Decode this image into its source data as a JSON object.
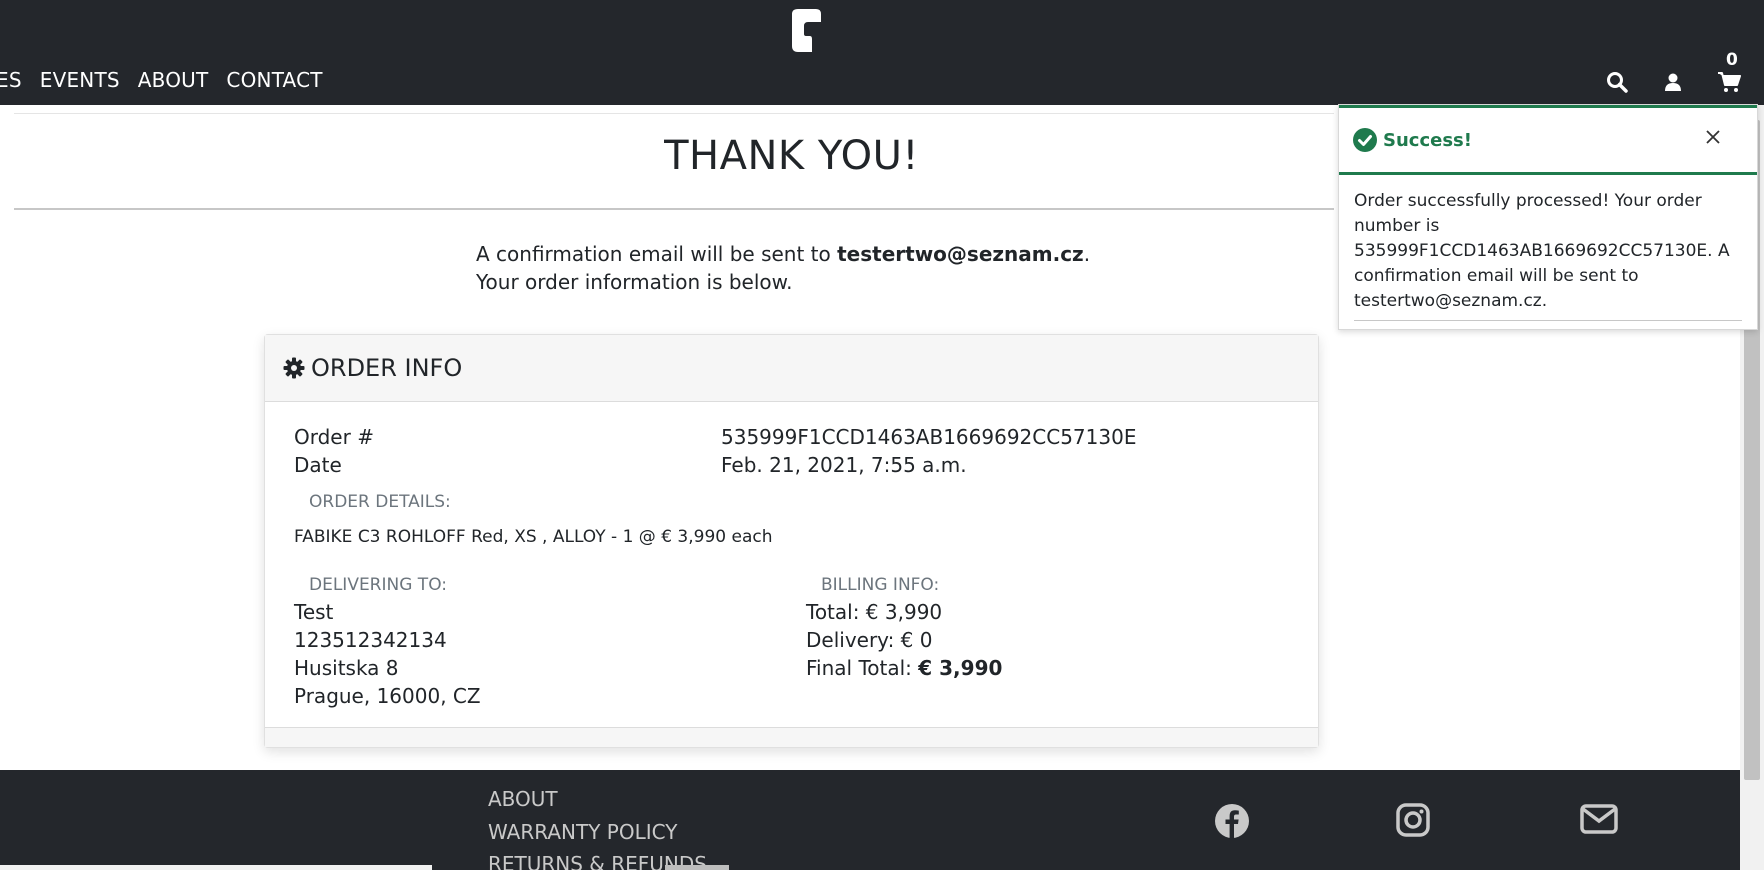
{
  "header": {
    "nav": [
      "ES",
      "EVENTS",
      "ABOUT",
      "CONTACT"
    ],
    "cart_count": "0",
    "icons": [
      "search-icon",
      "user-icon",
      "cart-icon"
    ]
  },
  "main": {
    "title": "THANK YOU!",
    "confirm_prefix": "A confirmation email will be sent to ",
    "confirm_email": "testertwo@seznam.cz",
    "confirm_suffix": ". Your order information is below."
  },
  "card": {
    "header_title": "ORDER INFO",
    "order_label": "Order #",
    "order_value": "535999F1CCD1463AB1669692CC57130E",
    "date_label": "Date",
    "date_value": "Feb. 21, 2021, 7:55 a.m.",
    "details_label": "ORDER DETAILS:",
    "item_line": "FABIKE C3 ROHLOFF Red, XS , ALLOY - 1 @ € 3,990 each",
    "delivering_label": "DELIVERING TO:",
    "delivery_lines": [
      "Test",
      "123512342134",
      "Husitska 8",
      "Prague, 16000, CZ"
    ],
    "billing_label": "BILLING INFO:",
    "total": "Total: € 3,990",
    "delivery": "Delivery: € 0",
    "final_label": "Final Total: ",
    "final_value": "€ 3,990"
  },
  "footer": {
    "links": [
      "ABOUT",
      "WARRANTY POLICY",
      "RETURNS & REFUNDS"
    ],
    "social_icons": [
      "facebook-icon",
      "instagram-icon",
      "mail-icon"
    ]
  },
  "toast": {
    "title": "Success!",
    "message": "Order successfully processed! Your order number is 535999F1CCD1463AB1669692CC57130E. A confirmation email will be sent to testertwo@seznam.cz."
  },
  "colors": {
    "header_bg": "#24272c",
    "success": "#1f7a4d"
  }
}
